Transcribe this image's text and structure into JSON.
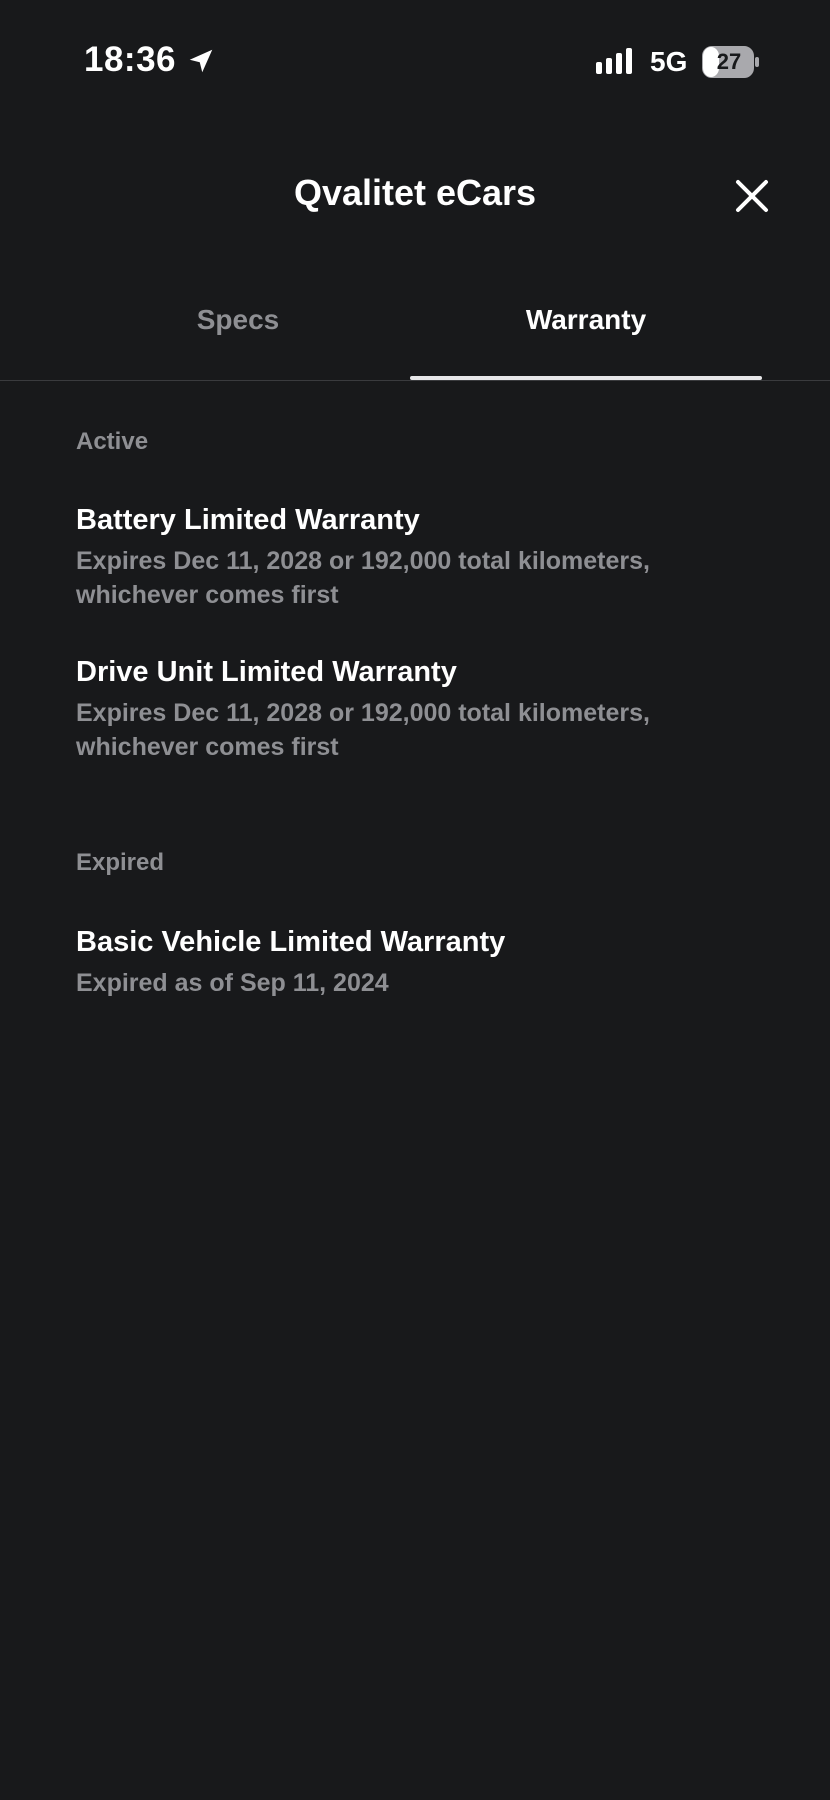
{
  "status_bar": {
    "time": "18:36",
    "network": "5G",
    "battery": "27"
  },
  "header": {
    "title": "Qvalitet eCars"
  },
  "tabs": [
    {
      "label": "Specs",
      "selected": false
    },
    {
      "label": "Warranty",
      "selected": true
    }
  ],
  "sections": {
    "active": {
      "label": "Active",
      "items": [
        {
          "title": "Battery Limited Warranty",
          "detail": "Expires Dec 11, 2028 or 192,000 total kilometers, whichever comes first"
        },
        {
          "title": "Drive Unit Limited Warranty",
          "detail": "Expires Dec 11, 2028 or 192,000 total kilometers, whichever comes first"
        }
      ]
    },
    "expired": {
      "label": "Expired",
      "items": [
        {
          "title": "Basic Vehicle Limited Warranty",
          "detail": "Expired as of Sep 11, 2024"
        }
      ]
    }
  },
  "icons": {
    "location": "location-arrow-icon",
    "signal": "cellular-signal-icon",
    "battery": "battery-icon",
    "close": "close-icon"
  },
  "colors": {
    "background": "#18191b",
    "primary_text": "#ffffff",
    "secondary_text": "#8e8f93",
    "tab_indicator": "#e7e7e9",
    "divider": "#3a3b3e"
  }
}
